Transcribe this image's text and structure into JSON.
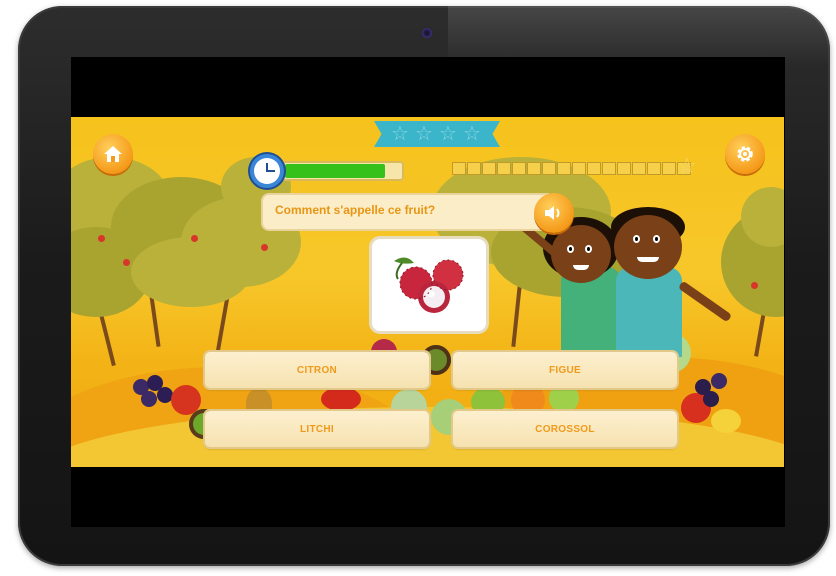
{
  "game": {
    "question": "Comment s'appelle ce fruit?",
    "timer_fraction": 0.86,
    "progress": {
      "total_cells": 16,
      "filled_cells": 0
    },
    "ribbon_stars": 4,
    "answers": [
      {
        "label": "CITRON"
      },
      {
        "label": "FIGUE"
      },
      {
        "label": "LITCHI"
      },
      {
        "label": "COROSSOL"
      }
    ],
    "icons": {
      "home": "home-icon",
      "settings": "gear-icon",
      "speaker": "speaker-icon",
      "clock": "clock-icon",
      "progress_star": "star-icon",
      "fruit_image": "lychee-image"
    },
    "colors": {
      "background": "#f6c21c",
      "answer_text": "#f09a1c",
      "question_text": "#e89615",
      "timer_fill": "#35c11a",
      "button_orange": "#f59a1a"
    }
  }
}
